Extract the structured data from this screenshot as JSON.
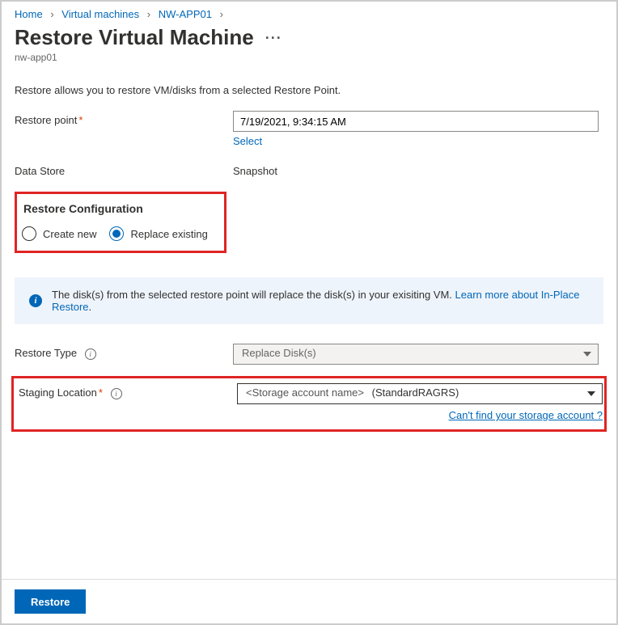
{
  "breadcrumb": {
    "home": "Home",
    "vms": "Virtual machines",
    "vm_name": "NW-APP01"
  },
  "page": {
    "title": "Restore Virtual Machine",
    "subtitle": "nw-app01",
    "description": "Restore allows you to restore VM/disks from a selected Restore Point."
  },
  "restore_point": {
    "label": "Restore point",
    "value": "7/19/2021, 9:34:15 AM",
    "select_link": "Select"
  },
  "data_store": {
    "label": "Data Store",
    "value": "Snapshot"
  },
  "config": {
    "section_title": "Restore Configuration",
    "create_new": "Create new",
    "replace_existing": "Replace existing",
    "selected": "replace_existing"
  },
  "info_banner": {
    "text": "The disk(s) from the selected restore point will replace the disk(s) in your exisiting VM. ",
    "link_label": "Learn more about In-Place Restore",
    "trailing": "."
  },
  "restore_type": {
    "label": "Restore Type",
    "value": "Replace Disk(s)"
  },
  "staging": {
    "label": "Staging Location",
    "placeholder": "<Storage account name>",
    "sku": "(StandardRAGRS)",
    "help_link": "Can't find your storage account ?"
  },
  "footer": {
    "restore": "Restore"
  }
}
